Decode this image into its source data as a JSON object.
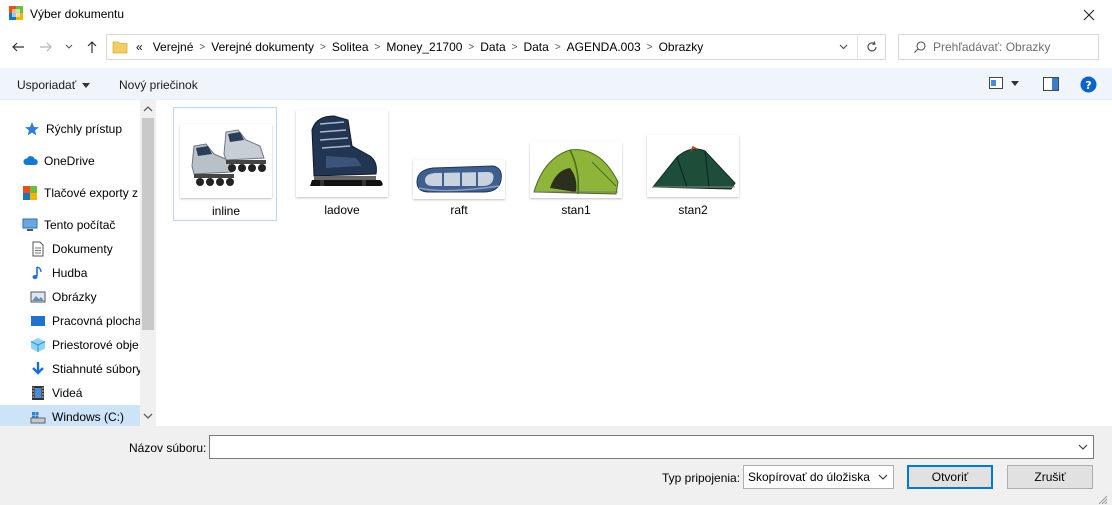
{
  "window": {
    "title": "Výber dokumentu"
  },
  "address": {
    "overflow": "«",
    "crumbs": [
      "Verejné",
      "Verejné dokumenty",
      "Solitea",
      "Money_21700",
      "Data",
      "Data",
      "AGENDA.003",
      "Obrazky"
    ]
  },
  "search": {
    "placeholder": "Prehľadávať: Obrazky"
  },
  "toolbar": {
    "organize": "Usporiadať",
    "new_folder": "Nový priečinok"
  },
  "sidebar": {
    "items": [
      {
        "label": "Rýchly prístup",
        "icon": "star-icon"
      },
      {
        "label": "OneDrive",
        "icon": "cloud-icon"
      },
      {
        "label": "Tlačové exporty z",
        "icon": "folder-icon"
      },
      {
        "label": "Tento počítač",
        "icon": "computer-icon"
      },
      {
        "label": "Dokumenty",
        "icon": "documents-icon"
      },
      {
        "label": "Hudba",
        "icon": "music-icon"
      },
      {
        "label": "Obrázky",
        "icon": "pictures-icon"
      },
      {
        "label": "Pracovná plocha",
        "icon": "desktop-icon"
      },
      {
        "label": "Priestorové obje",
        "icon": "3d-objects-icon"
      },
      {
        "label": "Stiahnuté súbory",
        "icon": "downloads-icon"
      },
      {
        "label": "Videá",
        "icon": "videos-icon"
      },
      {
        "label": "Windows  (C:)",
        "icon": "drive-icon"
      }
    ]
  },
  "files": [
    {
      "name": "inline",
      "icon": "inline-skates-image"
    },
    {
      "name": "ladove",
      "icon": "ice-skate-image"
    },
    {
      "name": "raft",
      "icon": "raft-image"
    },
    {
      "name": "stan1",
      "icon": "green-tent-image"
    },
    {
      "name": "stan2",
      "icon": "dark-tent-image"
    }
  ],
  "bottom": {
    "filename_label": "Názov súboru:",
    "filename_value": "",
    "attach_label": "Typ pripojenia:",
    "attach_value": "Skopírovať do úložiska",
    "open_button": "Otvoriť",
    "cancel_button": "Zrušiť"
  },
  "colors": {
    "accent": "#0078d7",
    "selection": "#cde3f7",
    "toolbar_bg": "#f0f5fb"
  }
}
